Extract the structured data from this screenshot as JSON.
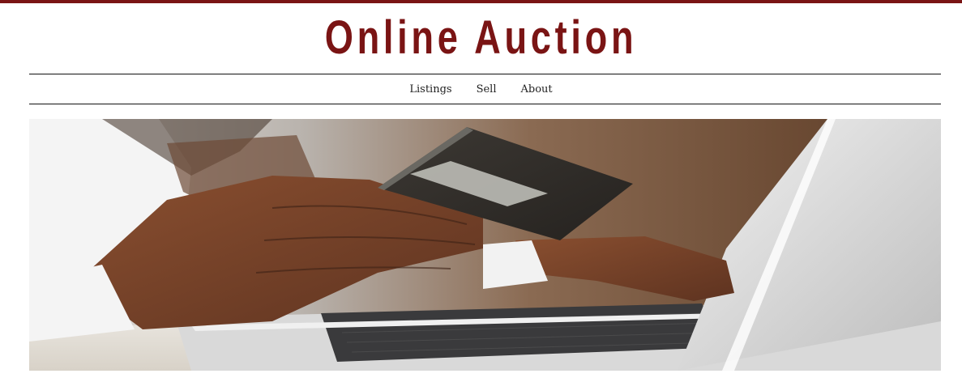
{
  "header": {
    "title": "Online Auction",
    "accent_color": "#7a1414"
  },
  "nav": {
    "items": [
      {
        "label": "Listings"
      },
      {
        "label": "Sell"
      },
      {
        "label": "About"
      }
    ]
  },
  "hero": {
    "image_subject": "hands-holding-credit-card-at-laptop"
  }
}
